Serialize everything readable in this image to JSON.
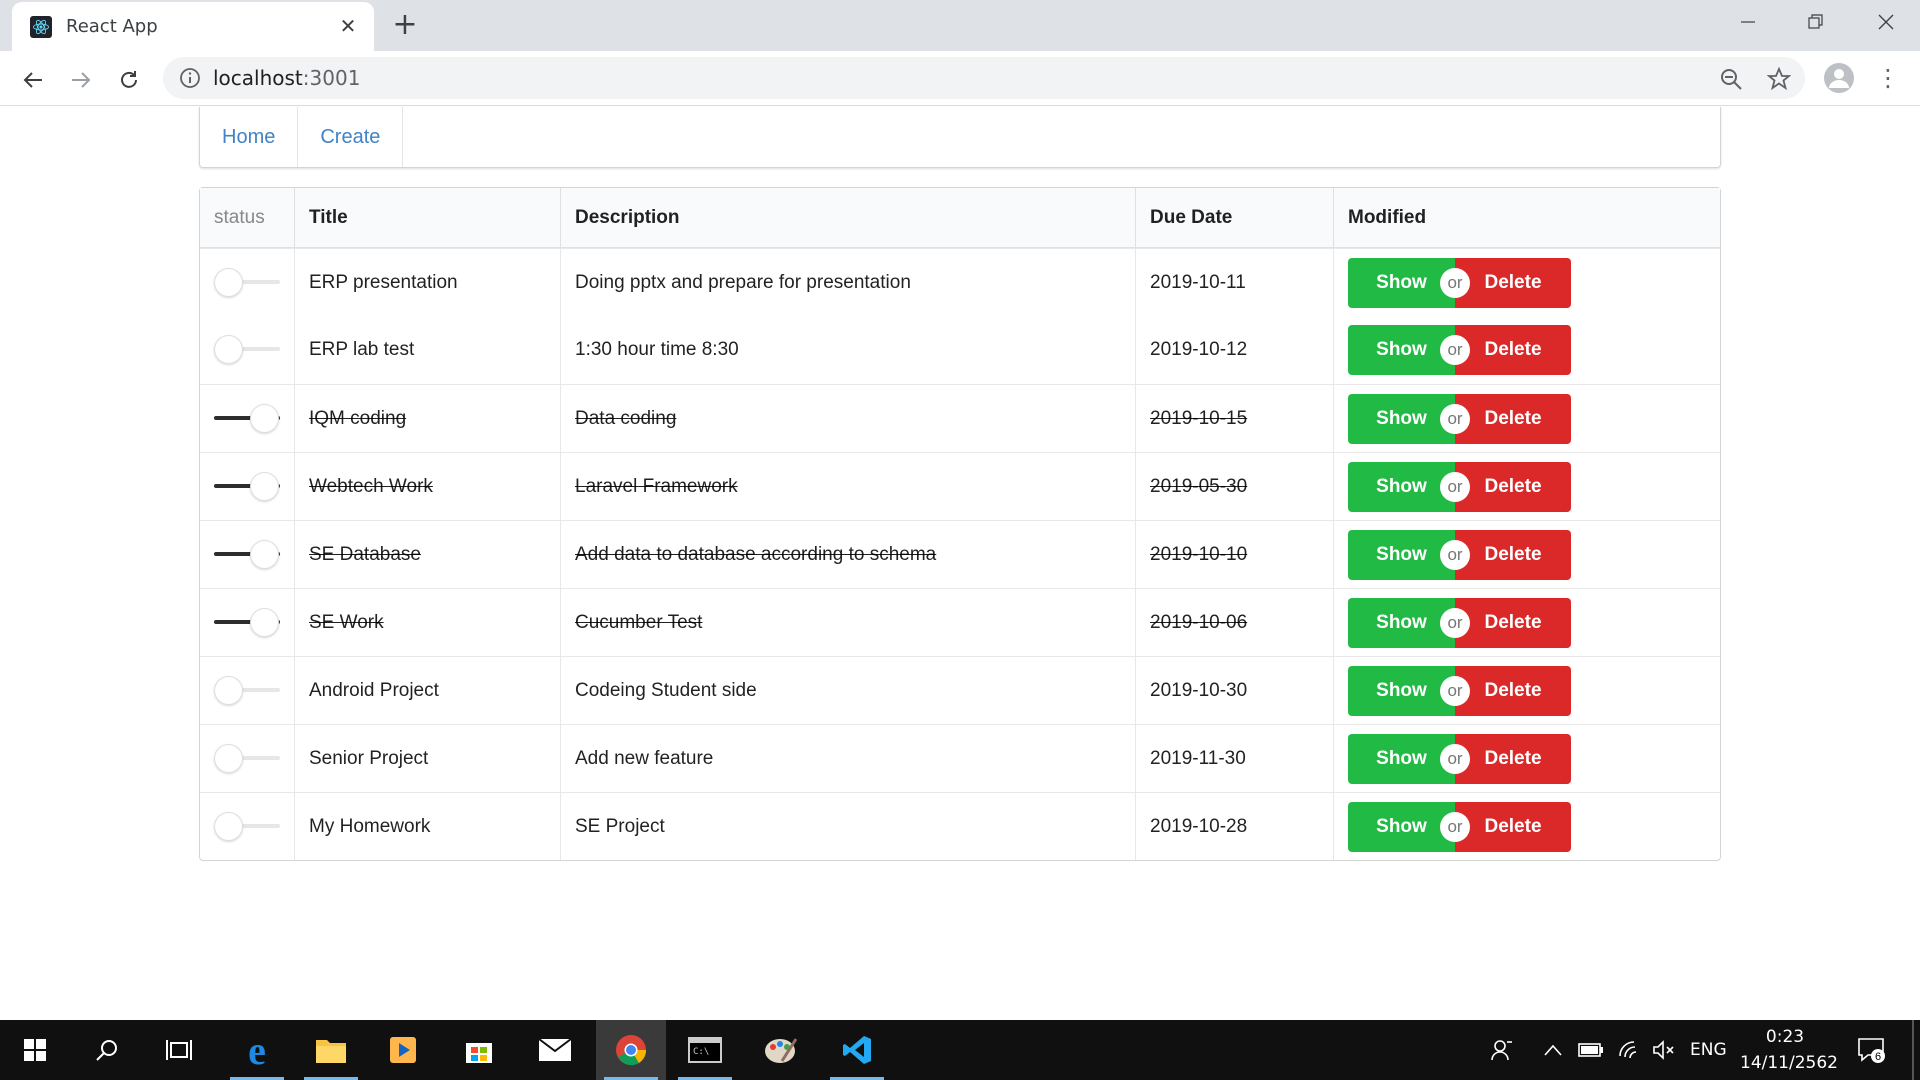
{
  "browser": {
    "tab_title": "React App",
    "url_host": "localhost",
    "url_port": ":3001",
    "new_tab_symbol": "+",
    "close_symbol": "✕"
  },
  "menu": {
    "items": [
      {
        "label": "Home"
      },
      {
        "label": "Create"
      }
    ]
  },
  "table": {
    "headers": [
      "status",
      "Title",
      "Description",
      "Due Date",
      "Modified"
    ],
    "rows": [
      {
        "done": false,
        "title": "ERP presentation",
        "description": "Doing pptx and prepare for presentation",
        "due": "2019-10-11"
      },
      {
        "done": false,
        "title": "ERP lab test",
        "description": "1:30 hour time 8:30",
        "due": "2019-10-12"
      },
      {
        "done": true,
        "title": "IQM coding",
        "description": "Data coding",
        "due": "2019-10-15"
      },
      {
        "done": true,
        "title": "Webtech Work",
        "description": "Laravel Framework",
        "due": "2019-05-30"
      },
      {
        "done": true,
        "title": "SE Database",
        "description": "Add data to database according to schema",
        "due": "2019-10-10"
      },
      {
        "done": true,
        "title": "SE Work",
        "description": "Cucumber Test",
        "due": "2019-10-06"
      },
      {
        "done": false,
        "title": "Android Project",
        "description": "Codeing Student side",
        "due": "2019-10-30"
      },
      {
        "done": false,
        "title": "Senior Project",
        "description": "Add new feature",
        "due": "2019-11-30"
      },
      {
        "done": false,
        "title": "My Homework",
        "description": "SE Project",
        "due": "2019-10-28"
      }
    ],
    "show_label": "Show",
    "or_label": "or",
    "delete_label": "Delete"
  },
  "colors": {
    "show": "#21ba45",
    "delete": "#db2828",
    "link": "#4183c4",
    "taskbar": "#101010"
  },
  "taskbar": {
    "apps": [
      "start-icon",
      "search-icon",
      "task-view-icon",
      "edge-icon",
      "file-explorer-icon",
      "media-player-icon",
      "store-icon",
      "mail-icon",
      "chrome-icon",
      "terminal-icon",
      "paint-icon",
      "vscode-icon"
    ],
    "language": "ENG",
    "time": "0:23",
    "date": "14/11/2562",
    "notification_count": "6"
  }
}
